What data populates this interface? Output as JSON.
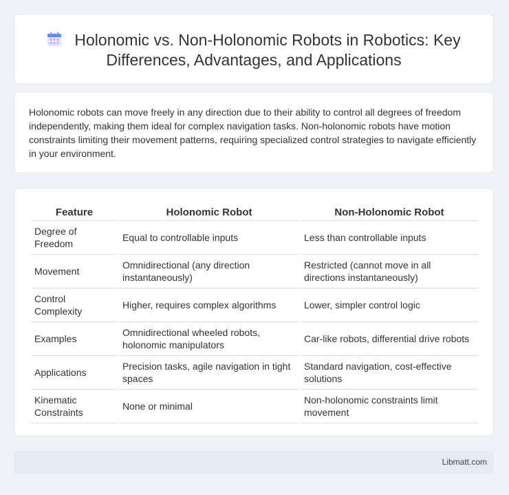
{
  "title": "Holonomic vs. Non-Holonomic Robots in Robotics: Key Differences, Advantages, and Applications",
  "title_icon": "calendar-icon",
  "intro": "Holonomic robots can move freely in any direction due to their ability to control all degrees of freedom independently, making them ideal for complex navigation tasks. Non-holonomic robots have motion constraints limiting their movement patterns, requiring specialized control strategies to navigate efficiently in your environment.",
  "table": {
    "headers": [
      "Feature",
      "Holonomic Robot",
      "Non-Holonomic Robot"
    ],
    "rows": [
      [
        "Degree of Freedom",
        "Equal to controllable inputs",
        "Less than controllable inputs"
      ],
      [
        "Movement",
        "Omnidirectional (any direction instantaneously)",
        "Restricted (cannot move in all directions instantaneously)"
      ],
      [
        "Control Complexity",
        "Higher, requires complex algorithms",
        "Lower, simpler control logic"
      ],
      [
        "Examples",
        "Omnidirectional wheeled robots, holonomic manipulators",
        "Car-like robots, differential drive robots"
      ],
      [
        "Applications",
        "Precision tasks, agile navigation in tight spaces",
        "Standard navigation, cost-effective solutions"
      ],
      [
        "Kinematic Constraints",
        "None or minimal",
        "Non-holonomic constraints limit movement"
      ]
    ]
  },
  "footer": "Libmatt.com",
  "colors": {
    "background": "#f0f2f7",
    "icon_top": "#5b8def",
    "icon_body": "#c9b8f0",
    "footer_bg": "#e5eaf5"
  }
}
